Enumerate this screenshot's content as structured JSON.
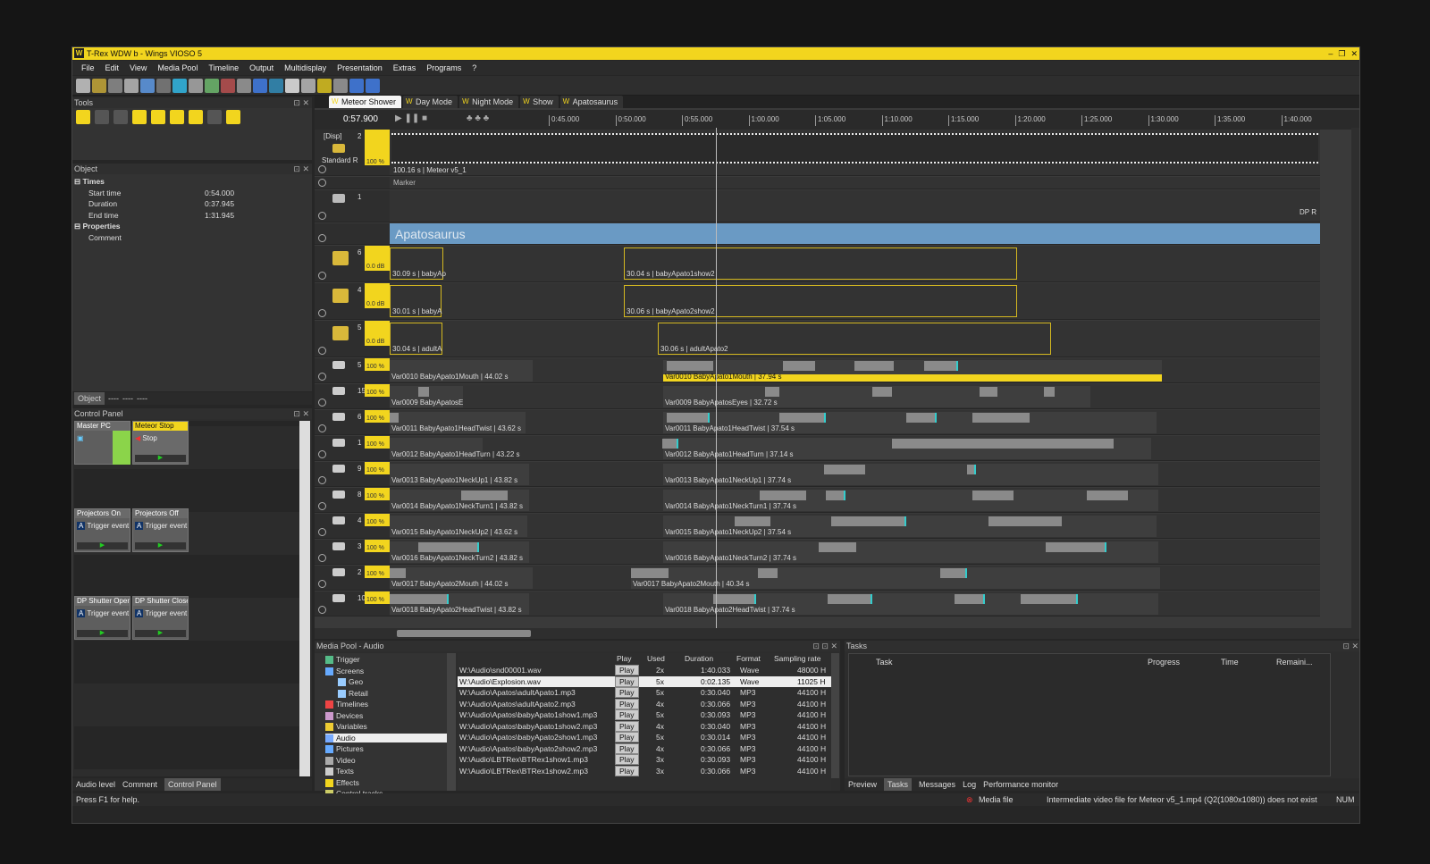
{
  "window": {
    "title": "T-Rex WDW b - Wings VIOSO 5",
    "controls": [
      "–",
      "❐",
      "✕"
    ]
  },
  "menu": [
    "File",
    "Edit",
    "View",
    "Media Pool",
    "Timeline",
    "Output",
    "Multidisplay",
    "Presentation",
    "Extras",
    "Programs",
    "?"
  ],
  "tools_title": "Tools",
  "object": {
    "title": "Object",
    "times_label": "Times",
    "rows": [
      {
        "k": "Start time",
        "v": "0:54.000"
      },
      {
        "k": "Duration",
        "v": "0:37.945"
      },
      {
        "k": "End time",
        "v": "1:31.945"
      }
    ],
    "properties_label": "Properties",
    "comment_label": "Comment"
  },
  "left_tabs": [
    "Object",
    "----",
    "----",
    "----"
  ],
  "control_panel": {
    "title": "Control Panel",
    "buttons": [
      {
        "title": "Master PC",
        "text": ""
      },
      {
        "title": "Meteor Stop",
        "text": "Stop"
      },
      {
        "title": "Projectors On",
        "text": "Trigger event"
      },
      {
        "title": "Projectors Off",
        "text": "Trigger event"
      },
      {
        "title": "DP Shutter Open",
        "text": "Trigger event"
      },
      {
        "title": "DP Shutter Close",
        "text": "Trigger event"
      }
    ]
  },
  "bottom_left_tabs": [
    "Audio level",
    "Comment",
    "Control Panel"
  ],
  "timeline": {
    "tabs": [
      "Meteor Shower",
      "Day Mode",
      "Night Mode",
      "Show",
      "Apatosaurus"
    ],
    "timecode": "0:57.900",
    "ticks": [
      "0:45.000",
      "0:50.000",
      "0:55.000",
      "1:00.000",
      "1:05.000",
      "1:10.000",
      "1:15.000",
      "1:20.000",
      "1:25.000",
      "1:30.000",
      "1:35.000",
      "1:40.000"
    ],
    "disp_track": {
      "label": "[Disp]",
      "num": "2",
      "sub": "Standard R",
      "pct": "100 %",
      "clip": "100.16 s | Meteor v5_1"
    },
    "marker": "Marker",
    "track1_num": "1",
    "dp": "DP R",
    "group": "Apatosaurus",
    "audio": [
      {
        "num": "6",
        "db": "0.0 dB",
        "a": "30.09 s | babyAp",
        "b": "30.04 s | babyApato1show2"
      },
      {
        "num": "4",
        "db": "0.0 dB",
        "a": "30.01 s | babyA",
        "b": "30.06 s | babyApato2show2"
      },
      {
        "num": "5",
        "db": "0.0 dB",
        "a": "30.04 s | adultA",
        "b": "30.06 s | adultApato2"
      }
    ],
    "vars": [
      {
        "num": "5",
        "pct": "100 %",
        "a": "Var0010 BabyApato1Mouth | 44.02 s",
        "b": "Var0010 BabyApato1Mouth | 37.94 s"
      },
      {
        "num": "15",
        "pct": "100 %",
        "a": "Var0009 BabyApatosE",
        "b": "Var0009 BabyApatosEyes | 32.72 s"
      },
      {
        "num": "6",
        "pct": "100 %",
        "a": "Var0011 BabyApato1HeadTwist | 43.62 s",
        "b": "Var0011 BabyApato1HeadTwist | 37.54 s"
      },
      {
        "num": "1",
        "pct": "100 %",
        "a": "Var0012 BabyApato1HeadTurn | 43.22 s",
        "b": "Var0012 BabyApato1HeadTurn | 37.14 s"
      },
      {
        "num": "9",
        "pct": "100 %",
        "a": "Var0013 BabyApato1NeckUp1 | 43.82 s",
        "b": "Var0013 BabyApato1NeckUp1 | 37.74 s"
      },
      {
        "num": "8",
        "pct": "100 %",
        "a": "Var0014 BabyApato1NeckTurn1 | 43.82 s",
        "b": "Var0014 BabyApato1NeckTurn1 | 37.74 s"
      },
      {
        "num": "4",
        "pct": "100 %",
        "a": "Var0015 BabyApato1NeckUp2 | 43.62 s",
        "b": "Var0015 BabyApato1NeckUp2 | 37.54 s"
      },
      {
        "num": "3",
        "pct": "100 %",
        "a": "Var0016 BabyApato1NeckTurn2 | 43.82 s",
        "b": "Var0016 BabyApato1NeckTurn2 | 37.74 s"
      },
      {
        "num": "2",
        "pct": "100 %",
        "a": "Var0017 BabyApato2Mouth | 44.02 s",
        "b": "Var0017 BabyApato2Mouth | 40.34 s"
      },
      {
        "num": "10",
        "pct": "100 %",
        "a": "Var0018 BabyApato2HeadTwist | 43.82 s",
        "b": "Var0018 BabyApato2HeadTwist | 37.74 s"
      }
    ]
  },
  "media_pool": {
    "title": "Media Pool - Audio",
    "tree": [
      "Trigger",
      "Screens",
      "Geo",
      "Retail",
      "Timelines",
      "Devices",
      "Variables",
      "Audio",
      "Pictures",
      "Video",
      "Texts",
      "Effects",
      "Control tracks"
    ],
    "columns": [
      "Play",
      "Used",
      "Duration",
      "Format",
      "Sampling rate"
    ],
    "rows": [
      {
        "name": "W:\\Audio\\snd00001.wav",
        "play": "Play",
        "used": "2x",
        "dur": "1:40.033",
        "fmt": "Wave",
        "rate": "48000 H"
      },
      {
        "name": "W:\\Audio\\Explosion.wav",
        "play": "Play",
        "used": "5x",
        "dur": "0:02.135",
        "fmt": "Wave",
        "rate": "11025 H"
      },
      {
        "name": "W:\\Audio\\Apatos\\adultApato1.mp3",
        "play": "Play",
        "used": "5x",
        "dur": "0:30.040",
        "fmt": "MP3",
        "rate": "44100 H"
      },
      {
        "name": "W:\\Audio\\Apatos\\adultApato2.mp3",
        "play": "Play",
        "used": "4x",
        "dur": "0:30.066",
        "fmt": "MP3",
        "rate": "44100 H"
      },
      {
        "name": "W:\\Audio\\Apatos\\babyApato1show1.mp3",
        "play": "Play",
        "used": "5x",
        "dur": "0:30.093",
        "fmt": "MP3",
        "rate": "44100 H"
      },
      {
        "name": "W:\\Audio\\Apatos\\babyApato1show2.mp3",
        "play": "Play",
        "used": "4x",
        "dur": "0:30.040",
        "fmt": "MP3",
        "rate": "44100 H"
      },
      {
        "name": "W:\\Audio\\Apatos\\babyApato2show1.mp3",
        "play": "Play",
        "used": "5x",
        "dur": "0:30.014",
        "fmt": "MP3",
        "rate": "44100 H"
      },
      {
        "name": "W:\\Audio\\Apatos\\babyApato2show2.mp3",
        "play": "Play",
        "used": "4x",
        "dur": "0:30.066",
        "fmt": "MP3",
        "rate": "44100 H"
      },
      {
        "name": "W:\\Audio\\LBTRex\\BTRex1show1.mp3",
        "play": "Play",
        "used": "3x",
        "dur": "0:30.093",
        "fmt": "MP3",
        "rate": "44100 H"
      },
      {
        "name": "W:\\Audio\\LBTRex\\BTRex1show2.mp3",
        "play": "Play",
        "used": "3x",
        "dur": "0:30.066",
        "fmt": "MP3",
        "rate": "44100 H"
      }
    ]
  },
  "tasks": {
    "title": "Tasks",
    "columns": [
      "Task",
      "Progress",
      "Time",
      "Remaini..."
    ],
    "tabs": [
      "Preview",
      "Tasks",
      "Messages",
      "Log",
      "Performance monitor"
    ]
  },
  "status": {
    "left": "Press F1 for help.",
    "media": "Media file",
    "msg": "Intermediate video file for Meteor v5_1.mp4 (Q2(1080x1080)) does not exist",
    "num": "NUM"
  },
  "colors": {
    "accent": "#f2d51e",
    "group": "#6a9ac4",
    "cyan": "#33cccc"
  }
}
